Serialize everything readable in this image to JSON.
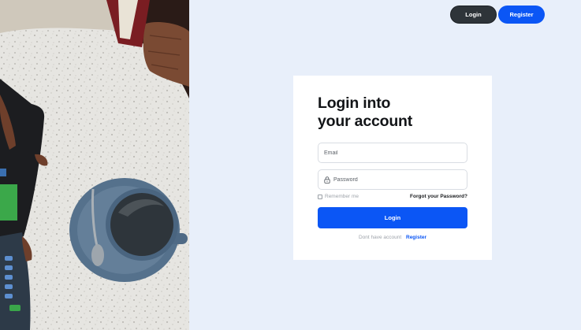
{
  "nav": {
    "login_label": "Login",
    "register_label": "Register"
  },
  "card": {
    "title_line1": "Login into",
    "title_line2": "your account",
    "email_placeholder": "Email",
    "password_placeholder": "Password",
    "remember_label": "Remember me",
    "forgot_label": "Forgot your Password?",
    "submit_label": "Login",
    "signup_prompt": "Dont have account",
    "signup_link": "Register"
  },
  "colors": {
    "page_bg": "#e8effa",
    "primary": "#0b56f5",
    "dark_button": "#2e3439"
  },
  "icons": {
    "password_icon": "lock-icon"
  }
}
